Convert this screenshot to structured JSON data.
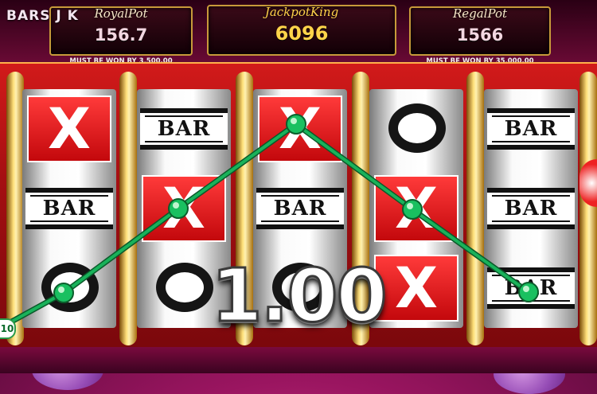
{
  "game": {
    "title": "BARS J K"
  },
  "jackpots": [
    {
      "name": "RoyalPot",
      "value": "156.7",
      "note": "MUST BE WON BY 3,500.00"
    },
    {
      "name": "JackpotKing",
      "value": "6096",
      "note": ""
    },
    {
      "name": "RegalPot",
      "value": "1566",
      "note": "MUST BE WON BY 35,000.00"
    }
  ],
  "reels": [
    [
      "X",
      "BAR",
      "O"
    ],
    [
      "BAR",
      "X",
      "O"
    ],
    [
      "X",
      "BAR",
      "O"
    ],
    [
      "O",
      "X",
      "X"
    ],
    [
      "BAR",
      "BAR",
      "BAR"
    ]
  ],
  "win": {
    "amount": "1.00",
    "line_label": "10"
  },
  "colors": {
    "payline": "#19b25a",
    "cabinet": "#c4141a",
    "gold": "#ffd24a"
  }
}
